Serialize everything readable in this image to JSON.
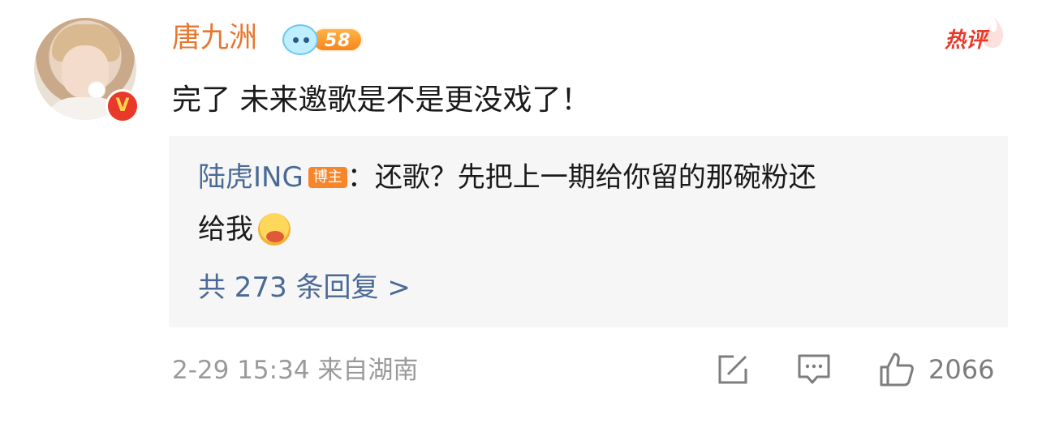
{
  "user": {
    "name": "唐九洲",
    "level": "58",
    "verified_mark": "V"
  },
  "hot_label": "热评",
  "comment": {
    "text": "完了 未来邀歌是不是更没戏了！"
  },
  "reply": {
    "author": "陆虎ING",
    "author_tag": "博主",
    "separator": "：",
    "text_line1": "还歌？先把上一期给你留的那碗粉还",
    "text_line2": "给我",
    "emoji": "yummy-face-emoji",
    "reply_count_label": "共 273 条回复 >"
  },
  "footer": {
    "timestamp": "2-29 15:34",
    "location": "来自湖南"
  },
  "actions": {
    "share_icon": "share-icon",
    "comment_icon": "comment-icon",
    "like_icon": "thumbs-up-icon",
    "like_count": "2066"
  },
  "colors": {
    "username": "#e8772e",
    "link": "#4a6a95",
    "hot": "#e8392a",
    "reply_bg": "#f6f6f6",
    "meta": "#9a9a9a"
  }
}
